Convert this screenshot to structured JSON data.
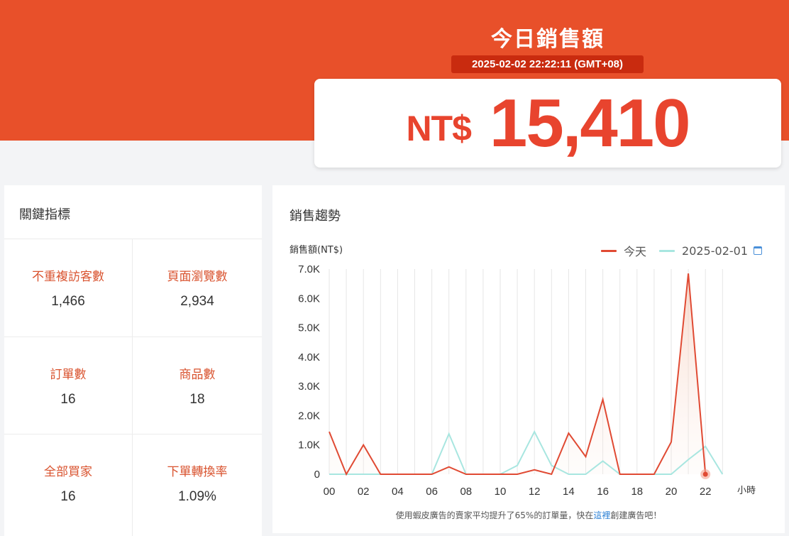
{
  "header": {
    "title": "今日銷售額",
    "timestamp": "2025-02-02 22:22:11 (GMT+08)",
    "currency": "NT$",
    "amount": "15,410"
  },
  "kpi": {
    "title": "關鍵指標",
    "items": [
      {
        "label": "不重複訪客數",
        "value": "1,466"
      },
      {
        "label": "頁面瀏覽數",
        "value": "2,934"
      },
      {
        "label": "訂單數",
        "value": "16"
      },
      {
        "label": "商品數",
        "value": "18"
      },
      {
        "label": "全部買家",
        "value": "16"
      },
      {
        "label": "下單轉換率",
        "value": "1.09%"
      }
    ]
  },
  "trend": {
    "title": "銷售趨勢",
    "tip_before": "使用蝦皮廣告的賣家平均提升了65%的訂單量，快在",
    "tip_link": "這裡",
    "tip_after": "創建廣告吧！"
  },
  "colors": {
    "brand": "#e8502a",
    "today_line": "#e04a33",
    "yesterday_line": "#a8e6e0"
  },
  "chart_data": {
    "type": "line",
    "ylabel": "銷售額(NT$)",
    "xlabel": "小時",
    "ylim": [
      0,
      7000
    ],
    "y_ticks": [
      "0",
      "1.0K",
      "2.0K",
      "3.0K",
      "4.0K",
      "5.0K",
      "6.0K",
      "7.0K"
    ],
    "y_tick_values": [
      0,
      1000,
      2000,
      3000,
      4000,
      5000,
      6000,
      7000
    ],
    "x_tick_labels": [
      "00",
      "02",
      "04",
      "06",
      "08",
      "10",
      "12",
      "14",
      "16",
      "18",
      "20",
      "22"
    ],
    "x": [
      0,
      1,
      2,
      3,
      4,
      5,
      6,
      7,
      8,
      9,
      10,
      11,
      12,
      13,
      14,
      15,
      16,
      17,
      18,
      19,
      20,
      21,
      22,
      23
    ],
    "legend_position": "top-right",
    "grid": "vertical",
    "series": [
      {
        "name": "今天",
        "color": "#e04a33",
        "fill": true,
        "values": [
          1450,
          0,
          1000,
          0,
          0,
          0,
          0,
          250,
          0,
          0,
          0,
          0,
          150,
          0,
          1400,
          600,
          2550,
          0,
          0,
          0,
          1100,
          6850,
          0
        ]
      },
      {
        "name": "2025-02-01",
        "color": "#a8e6e0",
        "fill": false,
        "values": [
          0,
          0,
          0,
          0,
          0,
          0,
          0,
          1380,
          0,
          0,
          0,
          300,
          1450,
          300,
          0,
          0,
          450,
          0,
          0,
          0,
          0,
          500,
          950,
          0
        ]
      }
    ]
  }
}
